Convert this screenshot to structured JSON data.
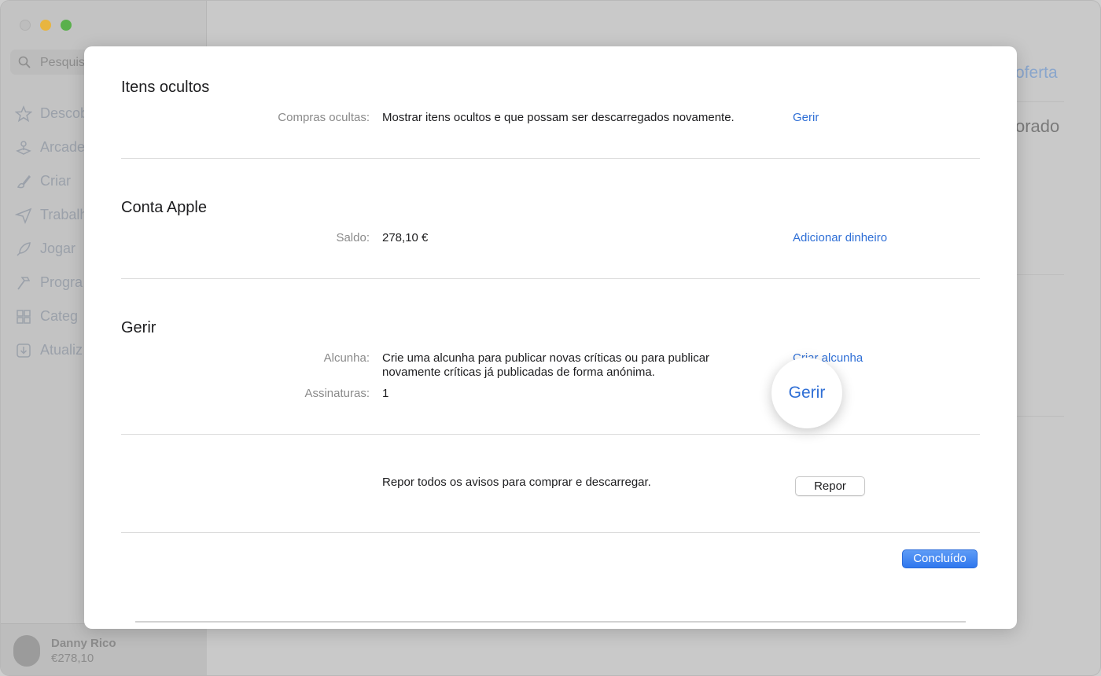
{
  "background": {
    "search_placeholder": "Pesquis",
    "sidebar": [
      {
        "label": "Descob",
        "icon": "star-icon"
      },
      {
        "label": "Arcade",
        "icon": "joystick-icon"
      },
      {
        "label": "Criar",
        "icon": "brush-icon"
      },
      {
        "label": "Trabalh",
        "icon": "paper-plane-icon"
      },
      {
        "label": "Jogar",
        "icon": "rocket-icon"
      },
      {
        "label": "Progra",
        "icon": "hammer-icon"
      },
      {
        "label": "Categ",
        "icon": "grid-icon"
      },
      {
        "label": "Atualiz",
        "icon": "download-icon"
      }
    ],
    "user": {
      "name": "Danny Rico",
      "balance": "€278,10"
    },
    "main": {
      "oferta": "oferta",
      "orado": "orado"
    }
  },
  "sheet": {
    "hidden": {
      "title": "Itens ocultos",
      "label": "Compras ocultas:",
      "value": "Mostrar itens ocultos e que possam ser descarregados novamente.",
      "link": "Gerir"
    },
    "account": {
      "title": "Conta Apple",
      "label": "Saldo:",
      "value": "278,10 €",
      "link": "Adicionar dinheiro"
    },
    "manage": {
      "title": "Gerir",
      "nickname_label": "Alcunha:",
      "nickname_value_line1": "Crie uma alcunha para publicar novas críticas ou para publicar",
      "nickname_value_line2": "novamente críticas já publicadas de forma anónima.",
      "nickname_link": "Criar alcunha",
      "subscriptions_label": "Assinaturas:",
      "subscriptions_value": "1",
      "subscriptions_link": "Gerir"
    },
    "reset": {
      "value": "Repor todos os avisos para comprar e descarregar.",
      "button": "Repor"
    },
    "done_button": "Concluído"
  },
  "colors": {
    "link": "#2f6fd6",
    "primary_button": "#2f77ee"
  }
}
